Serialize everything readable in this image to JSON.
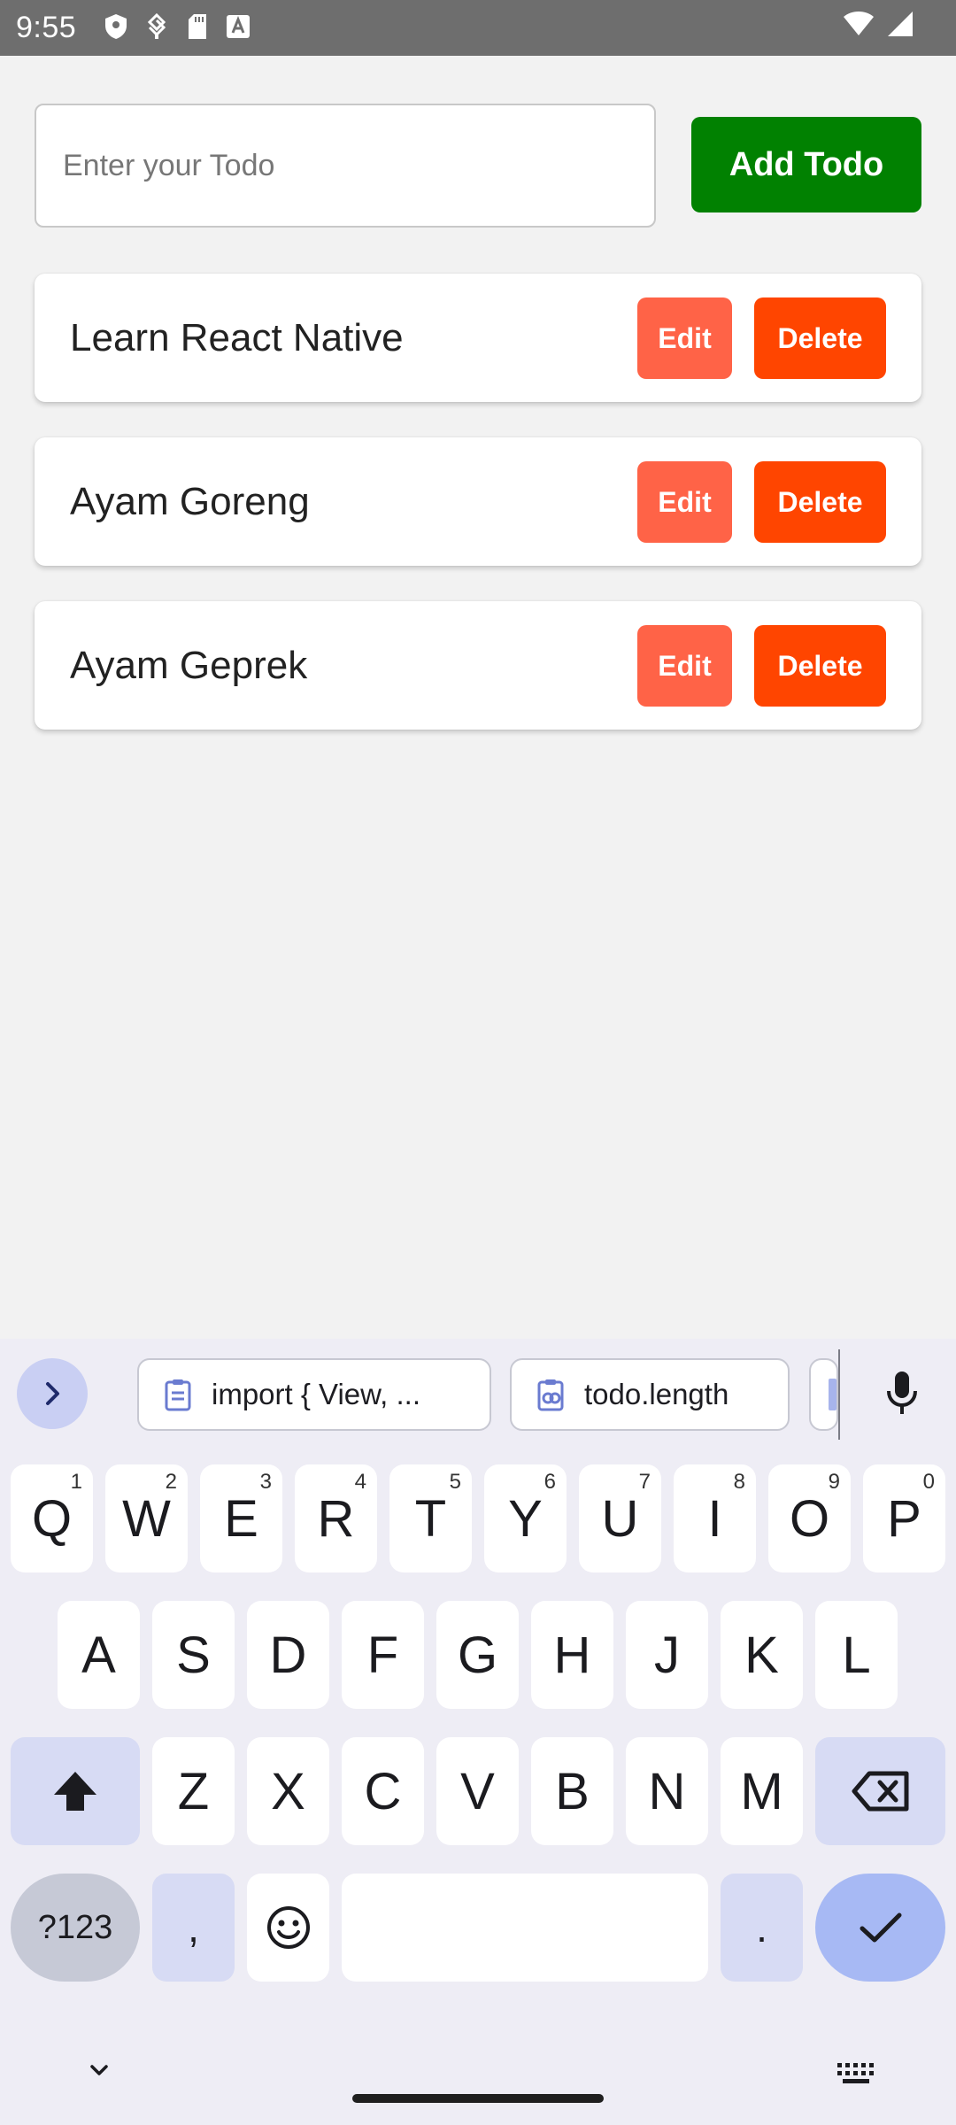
{
  "status_bar": {
    "time": "9:55"
  },
  "input": {
    "placeholder": "Enter your Todo",
    "value": ""
  },
  "add_button": {
    "label": "Add Todo"
  },
  "todos": [
    {
      "text": "Learn React Native",
      "edit_label": "Edit",
      "delete_label": "Delete"
    },
    {
      "text": "Ayam Goreng",
      "edit_label": "Edit",
      "delete_label": "Delete"
    },
    {
      "text": "Ayam Geprek",
      "edit_label": "Edit",
      "delete_label": "Delete"
    }
  ],
  "colors": {
    "add_button": "#018101",
    "edit_button": "#ff6347",
    "delete_button": "#ff4500",
    "app_background": "#f2f2f2"
  },
  "keyboard": {
    "clipboard_suggestions": [
      "import { View, ...",
      "todo.length"
    ],
    "row1": [
      {
        "key": "Q",
        "hint": "1"
      },
      {
        "key": "W",
        "hint": "2"
      },
      {
        "key": "E",
        "hint": "3"
      },
      {
        "key": "R",
        "hint": "4"
      },
      {
        "key": "T",
        "hint": "5"
      },
      {
        "key": "Y",
        "hint": "6"
      },
      {
        "key": "U",
        "hint": "7"
      },
      {
        "key": "I",
        "hint": "8"
      },
      {
        "key": "O",
        "hint": "9"
      },
      {
        "key": "P",
        "hint": "0"
      }
    ],
    "row2": [
      "A",
      "S",
      "D",
      "F",
      "G",
      "H",
      "J",
      "K",
      "L"
    ],
    "row3": [
      "Z",
      "X",
      "C",
      "V",
      "B",
      "N",
      "M"
    ],
    "symbols_label": "?123",
    "comma_label": ",",
    "period_label": "."
  }
}
